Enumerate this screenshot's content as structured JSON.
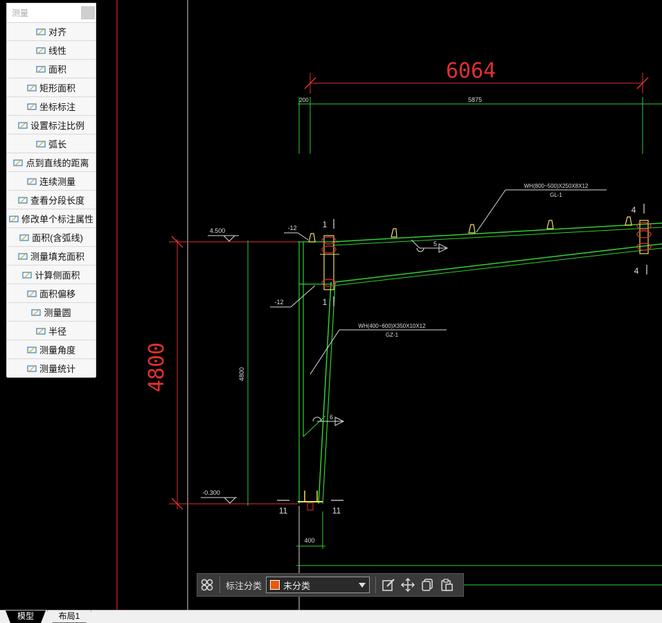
{
  "panel": {
    "title": "测量",
    "items": [
      {
        "label": "对齐",
        "icon": "aligned-dimension-icon"
      },
      {
        "label": "线性",
        "icon": "linear-dimension-icon"
      },
      {
        "label": "面积",
        "icon": "area-icon"
      },
      {
        "label": "矩形面积",
        "icon": "rect-area-icon"
      },
      {
        "label": "坐标标注",
        "icon": "coordinate-icon"
      },
      {
        "label": "设置标注比例",
        "icon": "scale-icon"
      },
      {
        "label": "弧长",
        "icon": "arc-length-icon"
      },
      {
        "label": "点到直线的距离",
        "icon": "point-line-distance-icon"
      },
      {
        "label": "连续测量",
        "icon": "continuous-measure-icon"
      },
      {
        "label": "查看分段长度",
        "icon": "segment-length-icon"
      },
      {
        "label": "修改单个标注属性",
        "icon": "edit-dimension-icon"
      },
      {
        "label": "面积(含弧线)",
        "icon": "arc-area-icon"
      },
      {
        "label": "测量填充面积",
        "icon": "hatch-area-icon"
      },
      {
        "label": "计算侧面积",
        "icon": "side-area-icon"
      },
      {
        "label": "面积偏移",
        "icon": "area-offset-icon"
      },
      {
        "label": "测量圆",
        "icon": "circle-icon"
      },
      {
        "label": "半径",
        "icon": "radius-icon"
      },
      {
        "label": "测量角度",
        "icon": "angle-icon"
      },
      {
        "label": "测量统计",
        "icon": "statistics-icon"
      }
    ]
  },
  "drawing": {
    "dim_top_large": "6064",
    "dim_top_200": "200",
    "dim_top_5875": "5875",
    "beam_label": "WH(800~500)X250X8X12",
    "beam_id": "GL-1",
    "col_label": "WH(400~600)X350X10X12",
    "col_id": "GZ-1",
    "elev_top": "4.500",
    "elev_bottom": "-0.300",
    "dim_left_large": "4800",
    "dim_left_small": "4800",
    "plate_top": "-12",
    "plate_mid": "-12",
    "weld_beam": "5",
    "weld_col": "6",
    "section_1a": "1",
    "section_1b": "1",
    "section_4a": "4",
    "section_4b": "4",
    "section_11a": "11",
    "section_11b": "11",
    "dim_base": "400"
  },
  "toolbar": {
    "category_label": "标注分类",
    "category_value": "未分类",
    "category_color": "#e8590c"
  },
  "tabs": {
    "model": "模型",
    "layout1": "布局1"
  }
}
